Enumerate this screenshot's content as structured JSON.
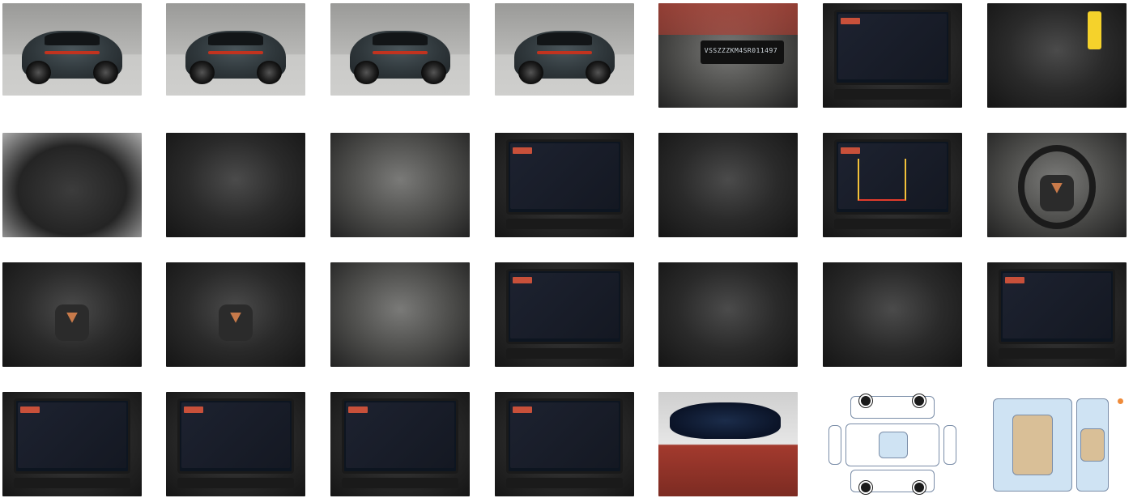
{
  "gallery": {
    "thumbnails": [
      {
        "label": "",
        "kind": "exterior-front-left"
      },
      {
        "label": "",
        "kind": "exterior-rear-left"
      },
      {
        "label": "",
        "kind": "exterior-rear"
      },
      {
        "label": "",
        "kind": "exterior-front-right"
      },
      {
        "label": "VSSZZZKM4SR011497",
        "kind": "vin-plate"
      },
      {
        "label": "",
        "kind": "instrument-cluster"
      },
      {
        "label": "",
        "kind": "car-key"
      },
      {
        "label": "",
        "kind": "trunk"
      },
      {
        "label": "",
        "kind": "trunk-button"
      },
      {
        "label": "",
        "kind": "rear-seats"
      },
      {
        "label": "",
        "kind": "dashboard-interior"
      },
      {
        "label": "",
        "kind": "rear-vents"
      },
      {
        "label": "",
        "kind": "reverse-camera"
      },
      {
        "label": "",
        "kind": "steering-wheel"
      },
      {
        "label": "",
        "kind": "steering-wheel-left-buttons"
      },
      {
        "label": "",
        "kind": "steering-wheel-right-buttons"
      },
      {
        "label": "",
        "kind": "door-window-controls"
      },
      {
        "label": "",
        "kind": "infotainment-clock"
      },
      {
        "label": "",
        "kind": "gear-selector"
      },
      {
        "label": "",
        "kind": "wireless-charger"
      },
      {
        "label": "",
        "kind": "infotainment-settings"
      },
      {
        "label": "",
        "kind": "infotainment-assistants"
      },
      {
        "label": "",
        "kind": "infotainment-drive-modes"
      },
      {
        "label": "",
        "kind": "infotainment-fulllink"
      },
      {
        "label": "",
        "kind": "infotainment-service"
      },
      {
        "label": "",
        "kind": "rearview-mirror"
      },
      {
        "label": "",
        "kind": "damage-diagram-exterior"
      },
      {
        "label": "",
        "kind": "damage-diagram-interior"
      }
    ]
  },
  "colors": {
    "accent_orange": "#ef8b3a",
    "diagram_blue": "#cfe3f3",
    "diagram_tan": "#d9bf97"
  }
}
